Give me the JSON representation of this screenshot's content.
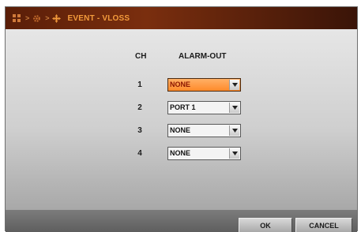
{
  "title": "EVENT - VLOSS",
  "breadcrumb_icons": [
    "grid-icon",
    "gear-icon",
    "move-icon"
  ],
  "colors": {
    "title_text": "#f39b3c",
    "active_select": "#ff8a2a",
    "titlebar": "#7a2e0e"
  },
  "table": {
    "headers": {
      "ch": "CH",
      "alarm_out": "ALARM-OUT"
    },
    "rows": [
      {
        "ch": "1",
        "alarm_out": "NONE",
        "active": true
      },
      {
        "ch": "2",
        "alarm_out": "PORT 1",
        "active": false
      },
      {
        "ch": "3",
        "alarm_out": "NONE",
        "active": false
      },
      {
        "ch": "4",
        "alarm_out": "NONE",
        "active": false
      }
    ]
  },
  "buttons": {
    "ok": "OK",
    "cancel": "CANCEL"
  }
}
